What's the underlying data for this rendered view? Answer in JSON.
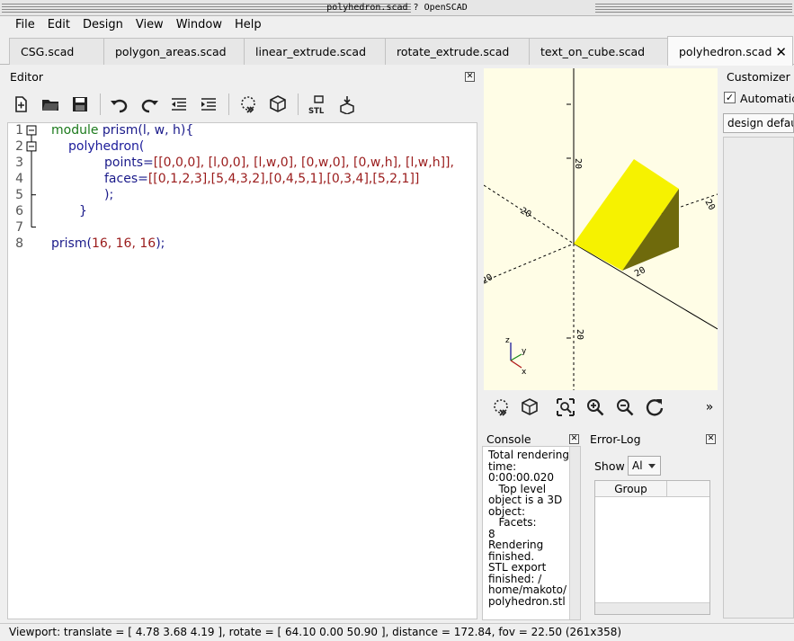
{
  "window": {
    "title": "polyhedron.scad ? OpenSCAD"
  },
  "menu": [
    "File",
    "Edit",
    "Design",
    "View",
    "Window",
    "Help"
  ],
  "tabs": [
    {
      "label": "CSG.scad"
    },
    {
      "label": "polygon_areas.scad"
    },
    {
      "label": "linear_extrude.scad"
    },
    {
      "label": "rotate_extrude.scad"
    },
    {
      "label": "text_on_cube.scad"
    },
    {
      "label": "polyhedron.scad",
      "active": true
    }
  ],
  "editor": {
    "label": "Editor",
    "toolbar": [
      "new-icon",
      "open-icon",
      "save-icon",
      "undo-icon",
      "redo-icon",
      "unindent-icon",
      "indent-icon",
      "preview-icon",
      "render-icon",
      "export-stl-icon",
      "send-to-print-icon"
    ],
    "stl_text": "STL",
    "lines": [
      {
        "n": "1"
      },
      {
        "n": "2"
      },
      {
        "n": "3"
      },
      {
        "n": "4"
      },
      {
        "n": "5"
      },
      {
        "n": "6"
      },
      {
        "n": "7"
      },
      {
        "n": "8"
      }
    ],
    "code": {
      "l1_kw": "module",
      "l1_rest_a": " prism(",
      "l1_args": "l, w, h",
      "l1_rest_b": "){",
      "l2_fn": "polyhedron(",
      "l3_a": "points=",
      "l3_b": "[[0,0,0], [l,0,0], [l,w,0], [0,w,0], [0,w,h], [l,w,h]],",
      "l4_a": "faces=",
      "l4_b": "[[0,1,2,3],[5,4,3,2],[0,4,5,1],[0,3,4],[5,2,1]]",
      "l5": ");",
      "l6": "}",
      "l8_a": "prism(",
      "l8_b": "16, 16, 16",
      "l8_c": ");"
    }
  },
  "viewport": {
    "axis_labels": {
      "z": "z",
      "y": "y",
      "x": "x"
    },
    "tick_labels": [
      "20",
      "20",
      "20",
      "20",
      "20",
      "20"
    ]
  },
  "view_toolbar": [
    "preview-icon",
    "render-icon",
    "view-all-icon",
    "zoom-in-icon",
    "zoom-out-icon",
    "reset-view-icon"
  ],
  "overflow": "»",
  "console": {
    "label": "Console",
    "lines": [
      "Total rendering",
      "time:",
      "0:00:00.020",
      "   Top level",
      "object is a 3D",
      "object:",
      "   Facets:",
      "8",
      "Rendering",
      "finished.",
      "STL export",
      "finished: /",
      "home/makoto/",
      "polyhedron.stl"
    ]
  },
  "error_log": {
    "label": "Error-Log",
    "show_label": "Show",
    "show_value": "Al",
    "column": "Group"
  },
  "customizer": {
    "label": "Customizer",
    "automatic_label": "Automatic",
    "automatic_checked": "✓",
    "preset": "design defaul"
  },
  "status": "Viewport: translate = [ 4.78 3.68 4.19 ], rotate = [ 64.10 0.00 50.90 ], distance = 172.84, fov = 22.50 (261x358)",
  "colors": {
    "model_face": "#f6f200",
    "model_shade": "#6f6a0c",
    "viewport_bg": "#fffde6"
  }
}
